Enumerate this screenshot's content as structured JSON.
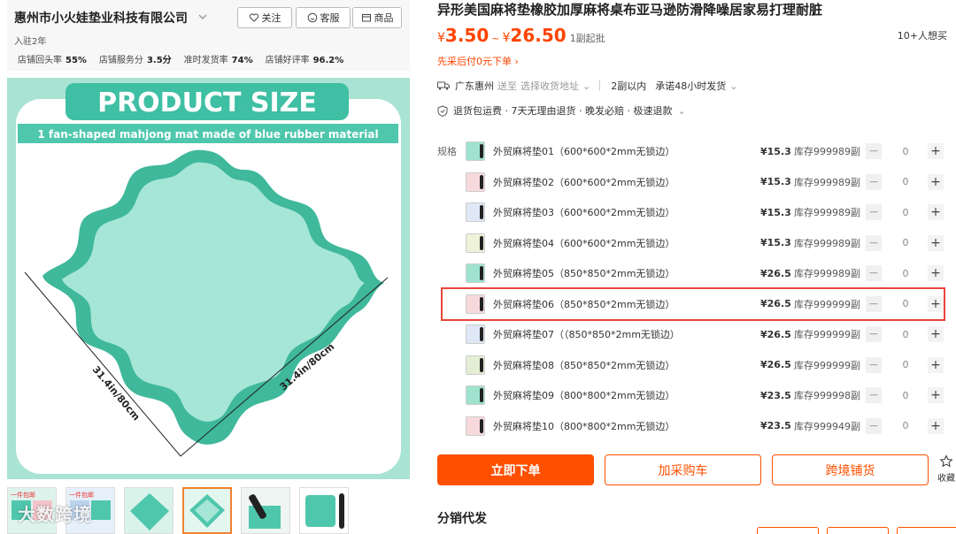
{
  "shop": {
    "name": "惠州市小火娃垫业科技有限公司",
    "years": "入驻2年",
    "follow_label": "关注",
    "service_label": "客服",
    "goods_label": "商品",
    "metrics": [
      {
        "label": "店铺回头率",
        "value": "55%"
      },
      {
        "label": "店铺服务分",
        "value": "3.5分"
      },
      {
        "label": "准时发货率",
        "value": "74%"
      },
      {
        "label": "店铺好评率",
        "value": "96.2%"
      }
    ]
  },
  "gallery": {
    "banner_title": "PRODUCT SIZE",
    "subtitle": "1 fan-shaped mahjong mat made of blue rubber material",
    "dim_left": "31.4in/80cm",
    "dim_right": "31.4in/80cm",
    "thumb_badge": "一件包邮",
    "watermark": "大数跨境"
  },
  "product": {
    "title": "异形美国麻将垫橡胶加厚麻将桌布亚马逊防滑降噪居家易打理耐脏",
    "currency": "¥",
    "price_low": "3.50",
    "price_high": "26.50",
    "price_tilde": "~",
    "moq": "1副起批",
    "wants": "10+人想买",
    "buy_now_pay_later": "先采后付0元下单",
    "ship_from": "广东惠州",
    "ship_to_prefix": "送至",
    "ship_to_placeholder": "选择收货地址",
    "ship_time": "2副以内",
    "ship_promise": "承诺48小时发货",
    "guarantee": "退货包运费 · 7天无理由退货 · 晚发必赔 · 极速退款"
  },
  "specs": {
    "label": "规格",
    "items": [
      {
        "name": "外贸麻将垫01（600*600*2mm无锁边）",
        "price": "¥15.3",
        "stock": "库存999989副",
        "qty": "0",
        "swatch": "#9fe3cf"
      },
      {
        "name": "外贸麻将垫02（600*600*2mm无锁边）",
        "price": "¥15.3",
        "stock": "库存999989副",
        "qty": "0",
        "swatch": "#f7d9dc"
      },
      {
        "name": "外贸麻将垫03（600*600*2mm无锁边）",
        "price": "¥15.3",
        "stock": "库存999989副",
        "qty": "0",
        "swatch": "#dfe8f5"
      },
      {
        "name": "外贸麻将垫04（600*600*2mm无锁边）",
        "price": "¥15.3",
        "stock": "库存999989副",
        "qty": "0",
        "swatch": "#eef2d8"
      },
      {
        "name": "外贸麻将垫05（850*850*2mm无锁边）",
        "price": "¥26.5",
        "stock": "库存999989副",
        "qty": "0",
        "swatch": "#9fe3cf"
      },
      {
        "name": "外贸麻将垫06（850*850*2mm无锁边）",
        "price": "¥26.5",
        "stock": "库存999999副",
        "qty": "0",
        "swatch": "#f7d9dc"
      },
      {
        "name": "外贸麻将垫07（（850*850*2mm无锁边）",
        "price": "¥26.5",
        "stock": "库存999999副",
        "qty": "0",
        "swatch": "#dfe8f5"
      },
      {
        "name": "外贸麻将垫08（850*850*2mm无锁边）",
        "price": "¥26.5",
        "stock": "库存999999副",
        "qty": "0",
        "swatch": "#e4eed5"
      },
      {
        "name": "外贸麻将垫09（800*800*2mm无锁边）",
        "price": "¥23.5",
        "stock": "库存999998副",
        "qty": "0",
        "swatch": "#9fe3cf"
      },
      {
        "name": "外贸麻将垫10（800*800*2mm无锁边）",
        "price": "¥23.5",
        "stock": "库存999949副",
        "qty": "0",
        "swatch": "#f7d9dc"
      }
    ],
    "minus": "−",
    "plus": "+"
  },
  "actions": {
    "order": "立即下单",
    "cart": "加采购车",
    "cross": "跨境铺货",
    "collect": "收藏"
  },
  "distribution": {
    "title": "分销代发"
  },
  "colors": {
    "accent": "#ff5000",
    "price": "#ff4400",
    "highlight": "#e8453c",
    "mat": "#4fc7ad"
  }
}
